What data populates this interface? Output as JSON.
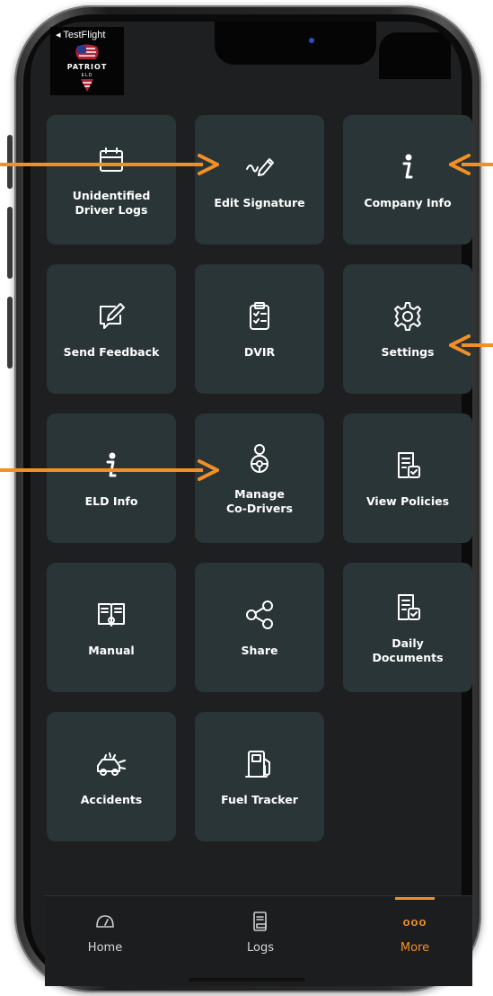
{
  "status": {
    "back_label": "◂ TestFlight"
  },
  "logo": {
    "text": "PATRIOT",
    "sub": "ELD"
  },
  "tiles": [
    {
      "label": "Unidentified\nDriver Logs",
      "icon": "calendar-icon"
    },
    {
      "label": "Edit Signature",
      "icon": "pen-signature-icon"
    },
    {
      "label": "Company Info",
      "icon": "info-icon"
    },
    {
      "label": "Send Feedback",
      "icon": "edit-feedback-icon"
    },
    {
      "label": "DVIR",
      "icon": "clipboard-checklist-icon"
    },
    {
      "label": "Settings",
      "icon": "gear-icon"
    },
    {
      "label": "ELD Info",
      "icon": "info-icon"
    },
    {
      "label": "Manage\nCo-Drivers",
      "icon": "driver-icon"
    },
    {
      "label": "View Policies",
      "icon": "policy-document-icon"
    },
    {
      "label": "Manual",
      "icon": "manual-book-icon"
    },
    {
      "label": "Share",
      "icon": "share-icon"
    },
    {
      "label": "Daily\nDocuments",
      "icon": "daily-document-icon"
    },
    {
      "label": "Accidents",
      "icon": "car-accident-icon"
    },
    {
      "label": "Fuel Tracker",
      "icon": "fuel-pump-icon"
    }
  ],
  "tabbar": {
    "home": {
      "label": "Home",
      "icon": "speedometer-icon"
    },
    "logs": {
      "label": "Logs",
      "icon": "logs-device-icon"
    },
    "more": {
      "label": "More",
      "icon_text": "ooo",
      "icon": "more-icon"
    }
  },
  "colors": {
    "accent": "#f39024",
    "tile": "#2a3538",
    "screen": "#1d1f21"
  }
}
